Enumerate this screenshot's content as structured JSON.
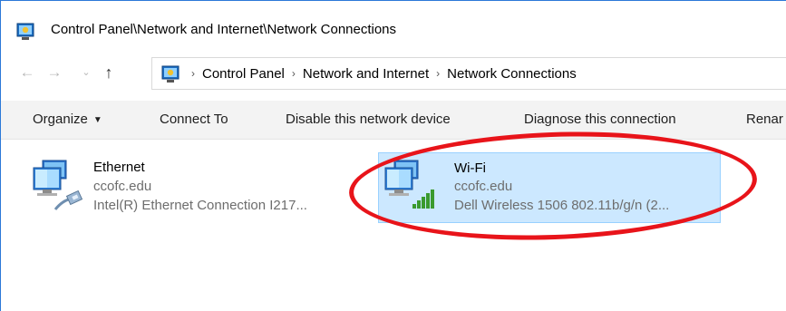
{
  "window": {
    "title": "Control Panel\\Network and Internet\\Network Connections"
  },
  "address": {
    "crumbs": [
      "Control Panel",
      "Network and Internet",
      "Network Connections"
    ],
    "separator": "›"
  },
  "commands": {
    "organize": "Organize",
    "connect_to": "Connect To",
    "disable": "Disable this network device",
    "diagnose": "Diagnose this connection",
    "rename": "Renar"
  },
  "connections": [
    {
      "name": "Ethernet",
      "network": "ccofc.edu",
      "adapter": "Intel(R) Ethernet Connection I217...",
      "icon": "ethernet-adapter-icon",
      "selected": false
    },
    {
      "name": "Wi-Fi",
      "network": "ccofc.edu",
      "adapter": "Dell Wireless 1506 802.11b/g/n (2...",
      "icon": "wifi-adapter-icon",
      "selected": true,
      "signal_bars": 5
    }
  ],
  "colors": {
    "selection_bg": "#cce8ff",
    "selection_border": "#99d1ff",
    "annotation": "#e8141a",
    "command_bar": "#f3f3f3"
  }
}
